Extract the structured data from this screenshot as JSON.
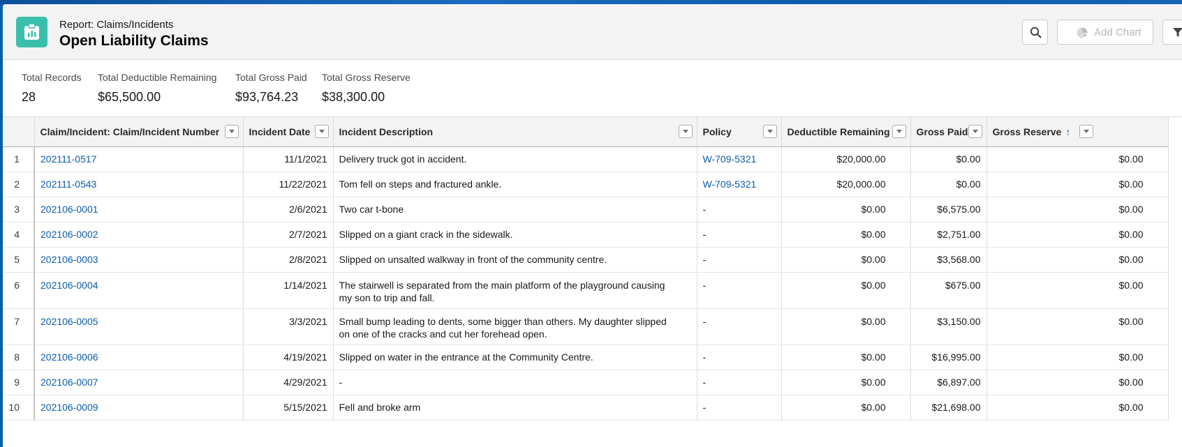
{
  "header": {
    "subtitle": "Report: Claims/Incidents",
    "title": "Open Liability Claims",
    "add_chart_label": "Add Chart",
    "icon": "report-icon"
  },
  "summary": [
    {
      "label": "Total Records",
      "value": "28"
    },
    {
      "label": "Total Deductible Remaining",
      "value": "$65,500.00"
    },
    {
      "label": "Total Gross Paid",
      "value": "$93,764.23"
    },
    {
      "label": "Total Gross Reserve",
      "value": "$38,300.00"
    }
  ],
  "table": {
    "columns": [
      "Claim/Incident: Claim/Incident Number",
      "Incident Date",
      "Incident Description",
      "Policy",
      "Deductible Remaining",
      "Gross Paid",
      "Gross Reserve"
    ],
    "sort_indicator": "↑",
    "rows": [
      {
        "n": "1",
        "claim": "202111-0517",
        "date": "11/1/2021",
        "desc": "Delivery truck got in accident.",
        "policy": "W-709-5321",
        "ded": "$20,000.00",
        "paid": "$0.00",
        "reserve": "$0.00"
      },
      {
        "n": "2",
        "claim": "202111-0543",
        "date": "11/22/2021",
        "desc": "Tom fell on steps and fractured ankle.",
        "policy": "W-709-5321",
        "ded": "$20,000.00",
        "paid": "$0.00",
        "reserve": "$0.00"
      },
      {
        "n": "3",
        "claim": "202106-0001",
        "date": "2/6/2021",
        "desc": "Two car t-bone",
        "policy": "-",
        "ded": "$0.00",
        "paid": "$6,575.00",
        "reserve": "$0.00"
      },
      {
        "n": "4",
        "claim": "202106-0002",
        "date": "2/7/2021",
        "desc": "Slipped on a giant crack in the sidewalk.",
        "policy": "-",
        "ded": "$0.00",
        "paid": "$2,751.00",
        "reserve": "$0.00"
      },
      {
        "n": "5",
        "claim": "202106-0003",
        "date": "2/8/2021",
        "desc": "Slipped on unsalted walkway in front of the community centre.",
        "policy": "-",
        "ded": "$0.00",
        "paid": "$3,568.00",
        "reserve": "$0.00"
      },
      {
        "n": "6",
        "claim": "202106-0004",
        "date": "1/14/2021",
        "desc": "The stairwell is separated from the main platform of the playground causing my son to trip and fall.",
        "policy": "-",
        "ded": "$0.00",
        "paid": "$675.00",
        "reserve": "$0.00"
      },
      {
        "n": "7",
        "claim": "202106-0005",
        "date": "3/3/2021",
        "desc": "Small bump leading to dents, some bigger than others. My daughter slipped on one of the cracks and cut her forehead open.",
        "policy": "-",
        "ded": "$0.00",
        "paid": "$3,150.00",
        "reserve": "$0.00"
      },
      {
        "n": "8",
        "claim": "202106-0006",
        "date": "4/19/2021",
        "desc": "Slipped on water in the entrance at the Community Centre.",
        "policy": "-",
        "ded": "$0.00",
        "paid": "$16,995.00",
        "reserve": "$0.00"
      },
      {
        "n": "9",
        "claim": "202106-0007",
        "date": "4/29/2021",
        "desc": "-",
        "policy": "-",
        "ded": "$0.00",
        "paid": "$6,897.00",
        "reserve": "$0.00"
      },
      {
        "n": "10",
        "claim": "202106-0009",
        "date": "5/15/2021",
        "desc": "Fell and broke arm",
        "policy": "-",
        "ded": "$0.00",
        "paid": "$21,698.00",
        "reserve": "$0.00"
      }
    ]
  }
}
